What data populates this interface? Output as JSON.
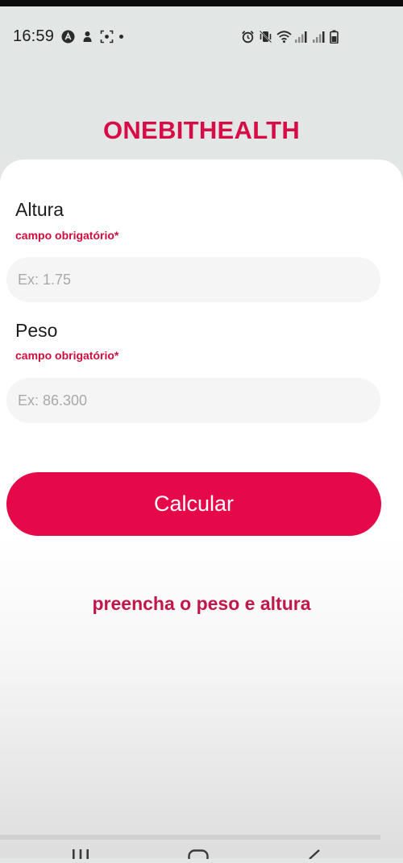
{
  "status_bar": {
    "time": "16:59",
    "left_icons": [
      "a-circle-icon",
      "notification-icon",
      "screenshot-icon",
      "dot-icon"
    ],
    "right_icons": [
      "alarm-icon",
      "vibrate-icon",
      "wifi-icon",
      "signal-icon",
      "signal-icon",
      "battery-icon"
    ]
  },
  "app": {
    "title": "ONEBITHEALTH"
  },
  "form": {
    "height": {
      "label": "Altura",
      "required_text": "campo obrigatório*",
      "placeholder": "Ex: 1.75",
      "value": ""
    },
    "weight": {
      "label": "Peso",
      "required_text": "campo obrigatório*",
      "placeholder": "Ex: 86.300",
      "value": ""
    },
    "submit_label": "Calcular"
  },
  "result": {
    "message": "preencha o peso e altura"
  },
  "nav_bar": {
    "buttons": [
      "recent-apps",
      "home",
      "back"
    ]
  },
  "colors": {
    "accent": "#e5094a",
    "title": "#d70b46",
    "message": "#c2174a",
    "background": "#e2e6e5"
  }
}
